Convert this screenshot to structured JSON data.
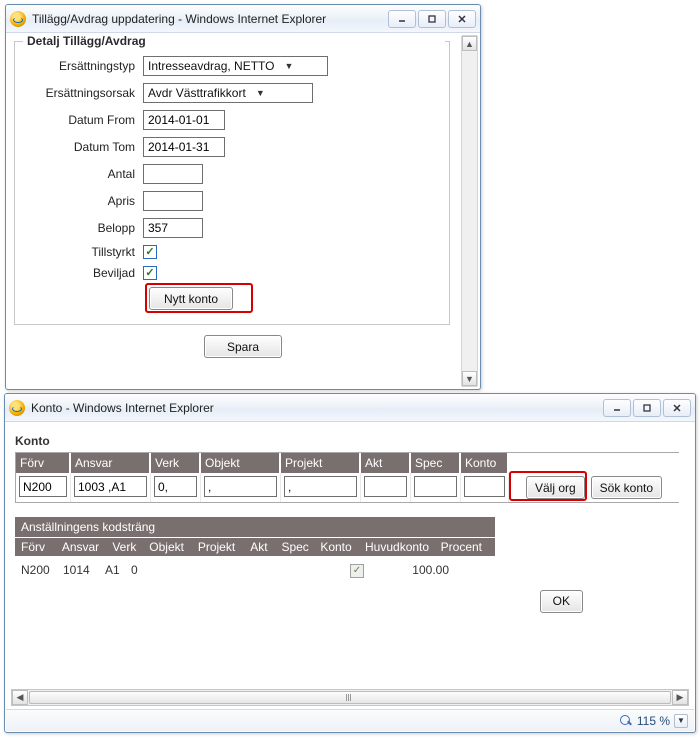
{
  "window1": {
    "title": "Tillägg/Avdrag uppdatering - Windows Internet Explorer",
    "legend": "Detalj Tillägg/Avdrag",
    "labels": {
      "ersattningstyp": "Ersättningstyp",
      "ersattningsorsak": "Ersättningsorsak",
      "datum_from": "Datum From",
      "datum_tom": "Datum Tom",
      "antal": "Antal",
      "apris": "Apris",
      "belopp": "Belopp",
      "tillstyrkt": "Tillstyrkt",
      "beviljad": "Beviljad"
    },
    "values": {
      "ersattningstyp": "Intresseavdrag, NETTO",
      "ersattningsorsak": "Avdr Västtrafikkort",
      "datum_from": "2014-01-01",
      "datum_tom": "2014-01-31",
      "antal": "",
      "apris": "",
      "belopp": "357",
      "tillstyrkt": true,
      "beviljad": true
    },
    "buttons": {
      "nytt_konto": "Nytt konto",
      "spara": "Spara"
    }
  },
  "window2": {
    "title": "Konto - Windows Internet Explorer",
    "panel_title": "Konto",
    "headers": [
      "Förv",
      "Ansvar",
      "Verk",
      "Objekt",
      "Projekt",
      "Akt",
      "Spec",
      "Konto"
    ],
    "row": {
      "forv": "N200",
      "ansvar": "1003 ,A1",
      "verk": "0,",
      "objekt": ",",
      "projekt": ",",
      "akt": "",
      "spec": "",
      "konto": ""
    },
    "buttons": {
      "valj_org": "Välj org",
      "sok_konto": "Sök konto",
      "ok": "OK"
    },
    "anst": {
      "title": "Anställningens kodsträng",
      "headers": [
        "Förv",
        "Ansvar",
        "Verk",
        "Objekt",
        "Projekt",
        "Akt",
        "Spec",
        "Konto",
        "Huvudkonto",
        "Procent"
      ],
      "data": {
        "forv": "N200",
        "ansvar": "1014",
        "verk": "A1",
        "objekt": "0",
        "projekt": "",
        "akt": "",
        "spec": "",
        "konto": "",
        "huvudkonto_checked": true,
        "procent": "100.00"
      }
    },
    "status": {
      "zoom": "115 %"
    }
  }
}
